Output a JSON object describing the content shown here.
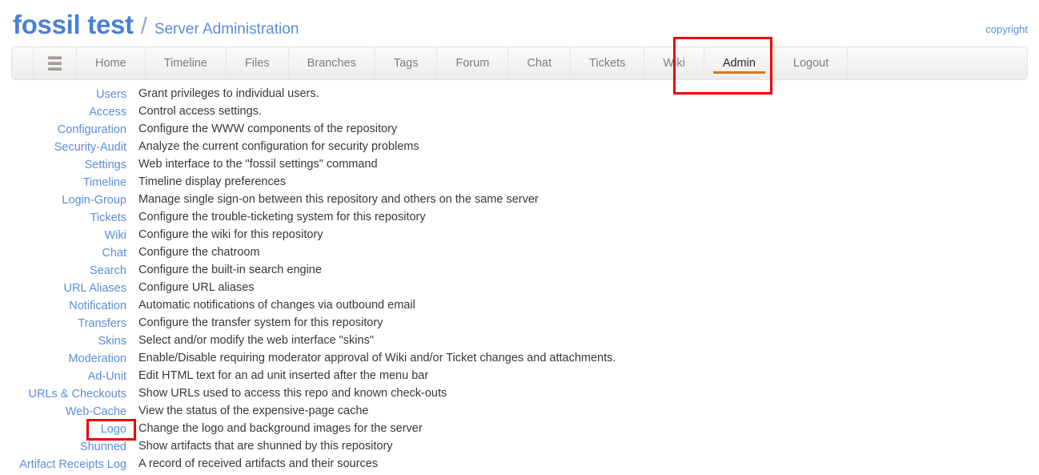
{
  "header": {
    "project_name": "fossil test",
    "separator": "/",
    "page_subtitle": "Server Administration",
    "copyright_label": "copyright"
  },
  "colors": {
    "brand_blue": "#4a7fd4",
    "link_blue": "#5b8dd9",
    "active_tab_underline": "#d4781b",
    "annotation_red": "#ee0000",
    "nav_text": "#7a7f86",
    "body_text": "#36383b"
  },
  "nav": {
    "menu_icon": "hamburger-icon",
    "items": [
      {
        "label": "Home",
        "active": false
      },
      {
        "label": "Timeline",
        "active": false
      },
      {
        "label": "Files",
        "active": false
      },
      {
        "label": "Branches",
        "active": false
      },
      {
        "label": "Tags",
        "active": false
      },
      {
        "label": "Forum",
        "active": false
      },
      {
        "label": "Chat",
        "active": false
      },
      {
        "label": "Tickets",
        "active": false
      },
      {
        "label": "Wiki",
        "active": false
      },
      {
        "label": "Admin",
        "active": true
      },
      {
        "label": "Logout",
        "active": false
      }
    ]
  },
  "admin_rows": [
    {
      "link": "Users",
      "desc": "Grant privileges to individual users.",
      "highlighted": false
    },
    {
      "link": "Access",
      "desc": "Control access settings.",
      "highlighted": false
    },
    {
      "link": "Configuration",
      "desc": "Configure the WWW components of the repository",
      "highlighted": false
    },
    {
      "link": "Security-Audit",
      "desc": "Analyze the current configuration for security problems",
      "highlighted": false
    },
    {
      "link": "Settings",
      "desc": "Web interface to the \"fossil settings\" command",
      "highlighted": false
    },
    {
      "link": "Timeline",
      "desc": "Timeline display preferences",
      "highlighted": false
    },
    {
      "link": "Login-Group",
      "desc": "Manage single sign-on between this repository and others on the same server",
      "highlighted": false
    },
    {
      "link": "Tickets",
      "desc": "Configure the trouble-ticketing system for this repository",
      "highlighted": false
    },
    {
      "link": "Wiki",
      "desc": "Configure the wiki for this repository",
      "highlighted": false
    },
    {
      "link": "Chat",
      "desc": "Configure the chatroom",
      "highlighted": false
    },
    {
      "link": "Search",
      "desc": "Configure the built-in search engine",
      "highlighted": false
    },
    {
      "link": "URL Aliases",
      "desc": "Configure URL aliases",
      "highlighted": false
    },
    {
      "link": "Notification",
      "desc": "Automatic notifications of changes via outbound email",
      "highlighted": false
    },
    {
      "link": "Transfers",
      "desc": "Configure the transfer system for this repository",
      "highlighted": false
    },
    {
      "link": "Skins",
      "desc": "Select and/or modify the web interface \"skins\"",
      "highlighted": false
    },
    {
      "link": "Moderation",
      "desc": "Enable/Disable requiring moderator approval of Wiki and/or Ticket changes and attachments.",
      "highlighted": false
    },
    {
      "link": "Ad-Unit",
      "desc": "Edit HTML text for an ad unit inserted after the menu bar",
      "highlighted": false
    },
    {
      "link": "URLs & Checkouts",
      "desc": "Show URLs used to access this repo and known check-outs",
      "highlighted": false
    },
    {
      "link": "Web-Cache",
      "desc": "View the status of the expensive-page cache",
      "highlighted": false
    },
    {
      "link": "Logo",
      "desc": "Change the logo and background images for the server",
      "highlighted": true
    },
    {
      "link": "Shunned",
      "desc": "Show artifacts that are shunned by this repository",
      "highlighted": false
    },
    {
      "link": "Artifact Receipts Log",
      "desc": "A record of received artifacts and their sources",
      "highlighted": false
    }
  ]
}
